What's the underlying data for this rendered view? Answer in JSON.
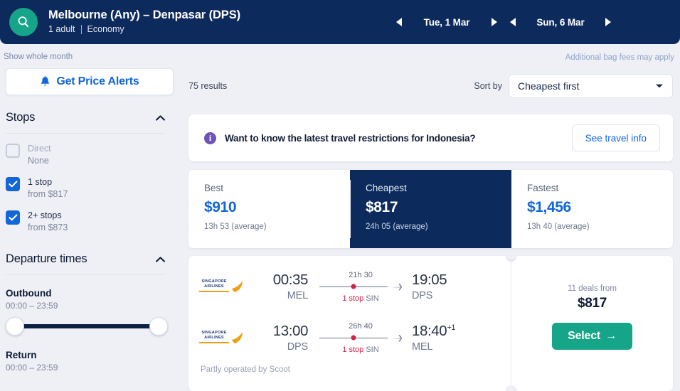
{
  "header": {
    "search_icon": "search-icon",
    "route": "Melbourne (Any) – Denpasar (DPS)",
    "passengers": "1 adult",
    "cabin_class": "Economy",
    "outbound_date": "Tue, 1 Mar",
    "return_date": "Sun, 6 Mar",
    "prev_arrow": "◀",
    "next_arrow": "▶",
    "accent_color": "#0c2a5b",
    "badge_color": "#17a589"
  },
  "links": {
    "show_whole_month": "Show whole month",
    "additional_bag_fees": "Additional bag fees may apply"
  },
  "sidebar": {
    "price_alerts_label": "Get Price Alerts",
    "price_alerts_icon": "bell-icon",
    "stops": {
      "title": "Stops",
      "collapse_icon": "chevron-up-icon",
      "options": [
        {
          "label": "Direct",
          "sub": "None",
          "checked": false,
          "disabled": true
        },
        {
          "label": "1 stop",
          "sub": "from $817",
          "checked": true,
          "disabled": false
        },
        {
          "label": "2+ stops",
          "sub": "from $873",
          "checked": true,
          "disabled": false
        }
      ]
    },
    "departure_times": {
      "title": "Departure times",
      "collapse_icon": "chevron-up-icon",
      "outbound_label": "Outbound",
      "outbound_range": "00:00 – 23:59",
      "return_label": "Return",
      "return_range": "00:00 – 23:59"
    }
  },
  "results": {
    "count_label": "75 results",
    "sort_by_label": "Sort by",
    "sort_value": "Cheapest first",
    "sort_icon": "chevron-down-icon"
  },
  "banner": {
    "icon": "info-icon",
    "text": "Want to know the latest travel restrictions for Indonesia?",
    "button_label": "See travel info"
  },
  "tabs": [
    {
      "name": "Best",
      "price": "$910",
      "duration": "13h 53 (average)",
      "active": false
    },
    {
      "name": "Cheapest",
      "price": "$817",
      "duration": "24h 05 (average)",
      "active": true
    },
    {
      "name": "Fastest",
      "price": "$1,456",
      "duration": "13h 40 (average)",
      "active": false
    }
  ],
  "flight_card": {
    "airline_name_line1": "SINGAPORE",
    "airline_name_line2": "AIRLINES",
    "airline_logo_icon": "singapore-airlines-logo",
    "legs": [
      {
        "depart_time": "00:35",
        "depart_airport": "MEL",
        "duration": "21h 30",
        "stops_count": "1 stop",
        "stop_airport": "SIN",
        "arrive_time": "19:05",
        "arrive_day_offset": "",
        "arrive_airport": "DPS",
        "plane_icon": "plane-icon"
      },
      {
        "depart_time": "13:00",
        "depart_airport": "DPS",
        "duration": "26h 40",
        "stops_count": "1 stop",
        "stop_airport": "SIN",
        "arrive_time": "18:40",
        "arrive_day_offset": "+1",
        "arrive_airport": "MEL",
        "plane_icon": "plane-icon"
      }
    ],
    "operated_note": "Partly operated by Scoot",
    "deals_label": "11 deals from",
    "deal_price": "$817",
    "select_label": "Select",
    "select_arrow": "→",
    "select_color": "#17a589"
  }
}
